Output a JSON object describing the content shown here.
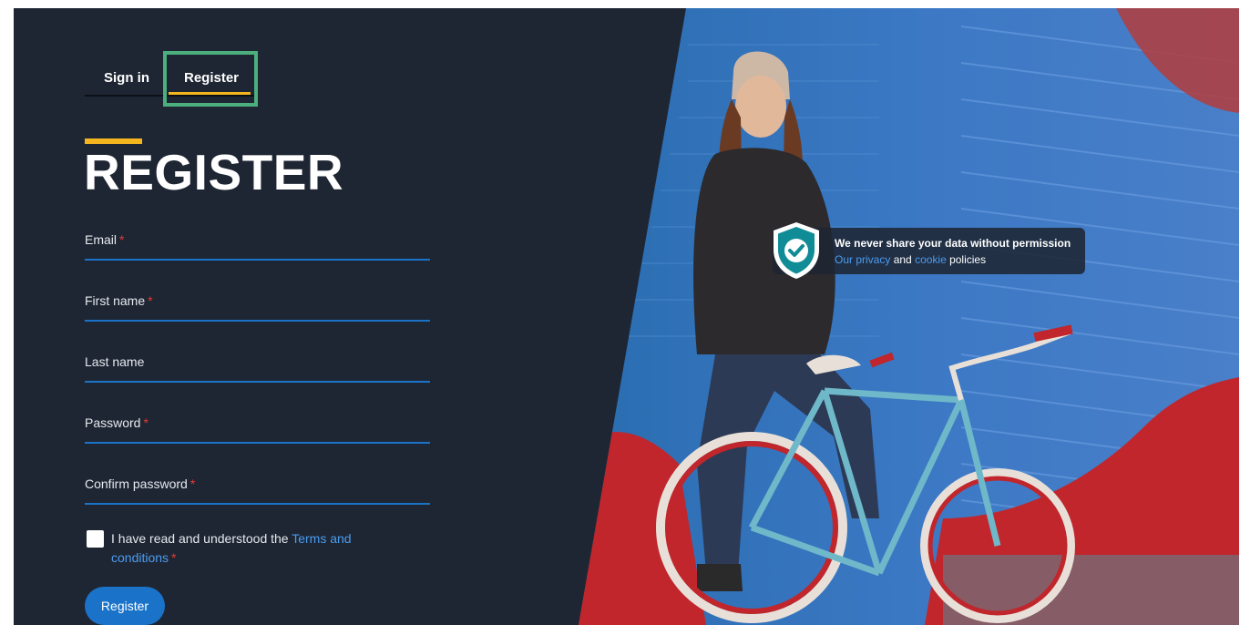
{
  "tabs": {
    "signin_label": "Sign in",
    "register_label": "Register"
  },
  "page": {
    "title": "REGISTER"
  },
  "form": {
    "email_label": "Email",
    "first_name_label": "First name",
    "last_name_label": "Last name",
    "password_label": "Password",
    "confirm_password_label": "Confirm password",
    "required_mark": "*",
    "terms_text": "I have read and understood the ",
    "terms_link": "Terms and conditions",
    "submit_label": "Register"
  },
  "privacy": {
    "headline": "We never share your data without permission",
    "privacy_link": "Our privacy",
    "and_text": " and ",
    "cookie_link": "cookie",
    "policies_text": " policies"
  },
  "colors": {
    "background": "#1e2633",
    "accent_yellow": "#f5b51f",
    "primary_blue": "#1a73c8",
    "link_blue": "#4b9cf0",
    "required_red": "#e53935",
    "highlight_green": "#4caf7d",
    "shield_teal": "#0f8c96"
  }
}
